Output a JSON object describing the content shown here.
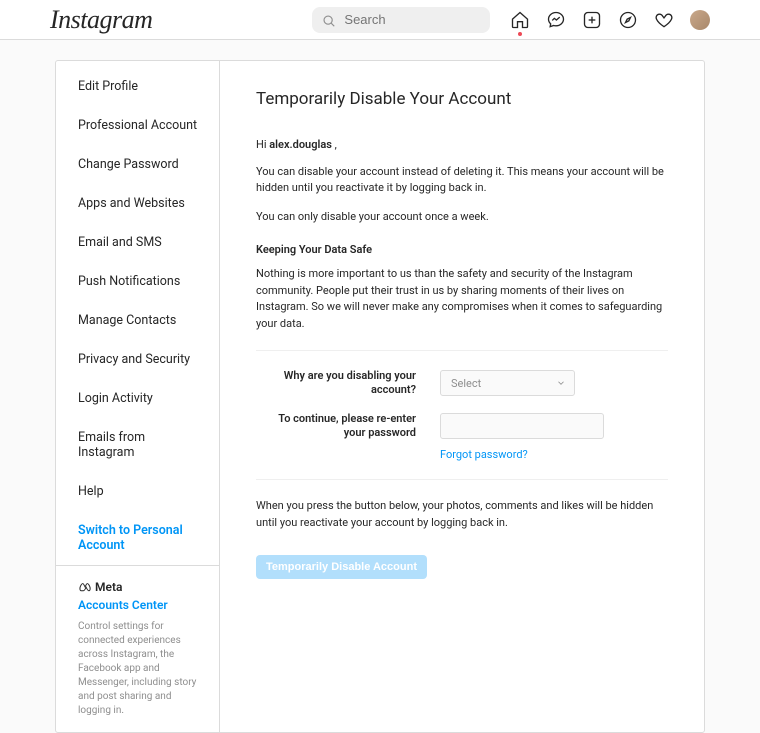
{
  "nav": {
    "logo": "Instagram",
    "search_placeholder": "Search"
  },
  "sidebar": {
    "items": [
      {
        "label": "Edit Profile"
      },
      {
        "label": "Professional Account"
      },
      {
        "label": "Change Password"
      },
      {
        "label": "Apps and Websites"
      },
      {
        "label": "Email and SMS"
      },
      {
        "label": "Push Notifications"
      },
      {
        "label": "Manage Contacts"
      },
      {
        "label": "Privacy and Security"
      },
      {
        "label": "Login Activity"
      },
      {
        "label": "Emails from Instagram"
      },
      {
        "label": "Help"
      },
      {
        "label": "Switch to Personal Account",
        "highlight": true
      }
    ],
    "meta": {
      "brand": "Meta",
      "link": "Accounts Center",
      "desc": "Control settings for connected experiences across Instagram, the Facebook app and Messenger, including story and post sharing and logging in."
    }
  },
  "content": {
    "title": "Temporarily Disable Your Account",
    "greeting_prefix": "Hi ",
    "username": "alex.douglas",
    "greeting_suffix": " ,",
    "p1": "You can disable your account instead of deleting it. This means your account will be hidden until you reactivate it by logging back in.",
    "p2": "You can only disable your account once a week.",
    "subhead": "Keeping Your Data Safe",
    "p3": "Nothing is more important to us than the safety and security of the Instagram community. People put their trust in us by sharing moments of their lives on Instagram. So we will never make any compromises when it comes to safeguarding your data.",
    "why_label": "Why are you disabling your account?",
    "why_placeholder": "Select",
    "pwd_label": "To continue, please re-enter your password",
    "forgot": "Forgot password?",
    "p4": "When you press the button below, your photos, comments and likes will be hidden until you reactivate your account by logging back in.",
    "button": "Temporarily Disable Account"
  }
}
